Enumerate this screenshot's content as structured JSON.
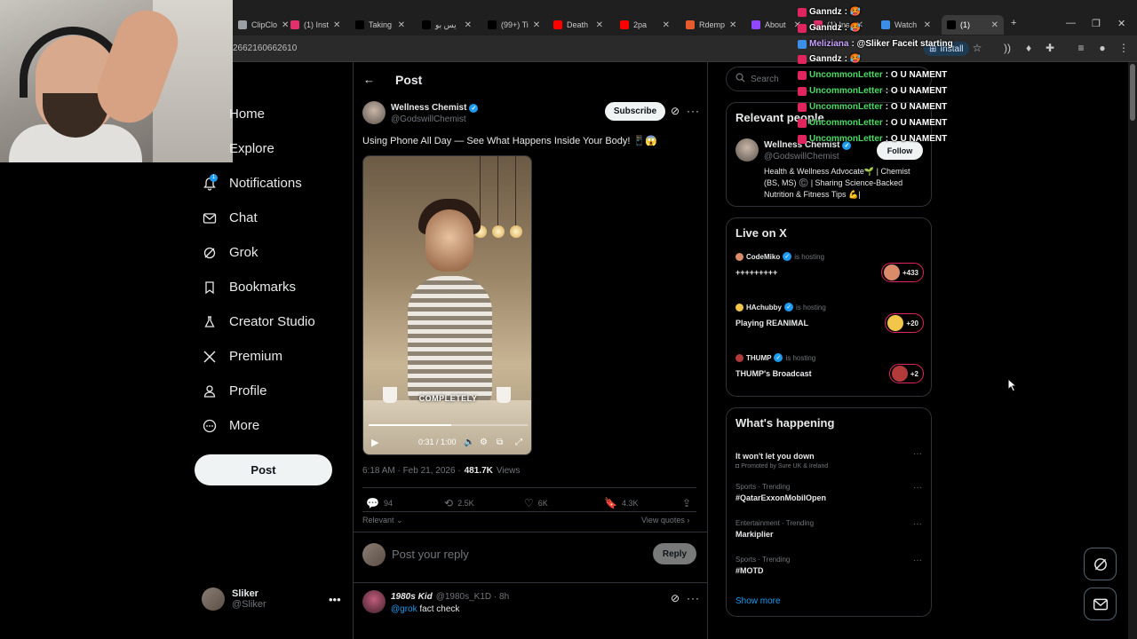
{
  "browser": {
    "tabs": [
      {
        "label": "ClipClo",
        "color": "#9aa0a6"
      },
      {
        "label": "(1) Inst",
        "color": "#e1306c"
      },
      {
        "label": "Taking",
        "color": "#000000"
      },
      {
        "label": "يس بو",
        "color": "#000000"
      },
      {
        "label": "(99+) Ti",
        "color": "#000000"
      },
      {
        "label": "Death",
        "color": "#ff0000"
      },
      {
        "label": "2pa",
        "color": "#ff0000"
      },
      {
        "label": "Rdemp",
        "color": "#e65c2c"
      },
      {
        "label": "About",
        "color": "#9146ff"
      },
      {
        "label": "(1) Ins",
        "color": "#e1306c"
      },
      {
        "label": "Watch",
        "color": "#3c8fe6"
      },
      {
        "label": "(1)",
        "color": "#000000"
      }
    ],
    "url": "2662160662610",
    "install_label": "Install"
  },
  "nav": {
    "items": [
      {
        "label": "Home",
        "icon": "home-icon"
      },
      {
        "label": "Explore",
        "icon": "search-icon"
      },
      {
        "label": "Notifications",
        "icon": "bell-icon"
      },
      {
        "label": "Chat",
        "icon": "mail-icon"
      },
      {
        "label": "Grok",
        "icon": "grok-icon"
      },
      {
        "label": "Bookmarks",
        "icon": "bookmark-icon"
      },
      {
        "label": "Creator Studio",
        "icon": "flask-icon"
      },
      {
        "label": "Premium",
        "icon": "x-logo-icon"
      },
      {
        "label": "Profile",
        "icon": "person-icon"
      },
      {
        "label": "More",
        "icon": "more-circle-icon"
      }
    ],
    "notification_count": "1",
    "post_label": "Post"
  },
  "account": {
    "name": "Sliker",
    "handle": "@Sliker"
  },
  "post": {
    "header_title": "Post",
    "author_name": "Wellness Chemist",
    "author_handle": "@GodswillChemist",
    "subscribe_label": "Subscribe",
    "text": "Using Phone All Day — See What Happens Inside Your Body! 📱😱",
    "video": {
      "caption": "COMPLETELY",
      "time": "0:31 / 1:00",
      "progress": 0.52
    },
    "time": "6:18 AM · Feb 21, 2026 ·",
    "views_count": "481.7K",
    "views_label": "Views",
    "stats": {
      "replies": "94",
      "reposts": "2.5K",
      "likes": "6K",
      "bookmarks": "4.3K"
    },
    "sort_label": "Relevant",
    "view_quotes_label": "View quotes ›",
    "reply_placeholder": "Post your reply",
    "reply_button": "Reply"
  },
  "comment": {
    "name": "1980s Kid",
    "handle": "@1980s_K1D · 8h",
    "mention": "@grok",
    "text": "fact check"
  },
  "sidebar": {
    "search_placeholder": "Search",
    "relevant_people": {
      "title": "Relevant people",
      "name": "Wellness Chemist",
      "handle": "@GodswillChemist",
      "follow_label": "Follow",
      "bio": "Health & Wellness Advocate🌱 | Chemist (BS, MS) ©️ | Sharing Science-Backed Nutrition & Fitness Tips 💪|"
    },
    "live": {
      "title": "Live on X",
      "hosting_label": "is hosting",
      "items": [
        {
          "host": "CodeMiko",
          "title": "+++++++++",
          "listeners": "+433",
          "color": "#d98b6a"
        },
        {
          "host": "HAchubby",
          "title": "Playing REANIMAL",
          "listeners": "+20",
          "color": "#f2c64b"
        },
        {
          "host": "THUMP",
          "title": "THUMP's Broadcast",
          "listeners": "+2",
          "color": "#b23a3a"
        }
      ]
    },
    "trends": {
      "title": "What's happening",
      "items": [
        {
          "category": "",
          "name": "It won't let you down",
          "sub": "Promoted by Sure UK & Ireland"
        },
        {
          "category": "Sports · Trending",
          "name": "#QatarExxonMobilOpen",
          "sub": ""
        },
        {
          "category": "Entertainment · Trending",
          "name": "Markiplier",
          "sub": ""
        },
        {
          "category": "Sports · Trending",
          "name": "#MOTD",
          "sub": ""
        }
      ],
      "show_more": "Show more"
    }
  },
  "chat": [
    {
      "user": "Ganndz",
      "msg": ": 🥵",
      "color": "#ffffff"
    },
    {
      "user": "Ganndz",
      "msg": ": 🥵",
      "color": "#ffffff"
    },
    {
      "user": "Meliziana",
      "msg": ": @Sliker Faceit starting",
      "color": "#c8a2ff"
    },
    {
      "user": "Ganndz",
      "msg": ": 🥵",
      "color": "#ffffff"
    },
    {
      "user": "UncommonLetter",
      "msg": ": O U NAMENT",
      "color": "#4cd964"
    },
    {
      "user": "UncommonLetter",
      "msg": ": O U NAMENT",
      "color": "#4cd964"
    },
    {
      "user": "UncommonLetter",
      "msg": ": O U NAMENT",
      "color": "#4cd964"
    },
    {
      "user": "UncommonLetter",
      "msg": ": O U NAMENT",
      "color": "#4cd964"
    },
    {
      "user": "UncommonLetter",
      "msg": ": O U NAMENT",
      "color": "#4cd964"
    }
  ],
  "colors": {
    "accent": "#1d9bf0",
    "background": "#000000",
    "border": "#2f3336",
    "live": "#e0245e"
  }
}
